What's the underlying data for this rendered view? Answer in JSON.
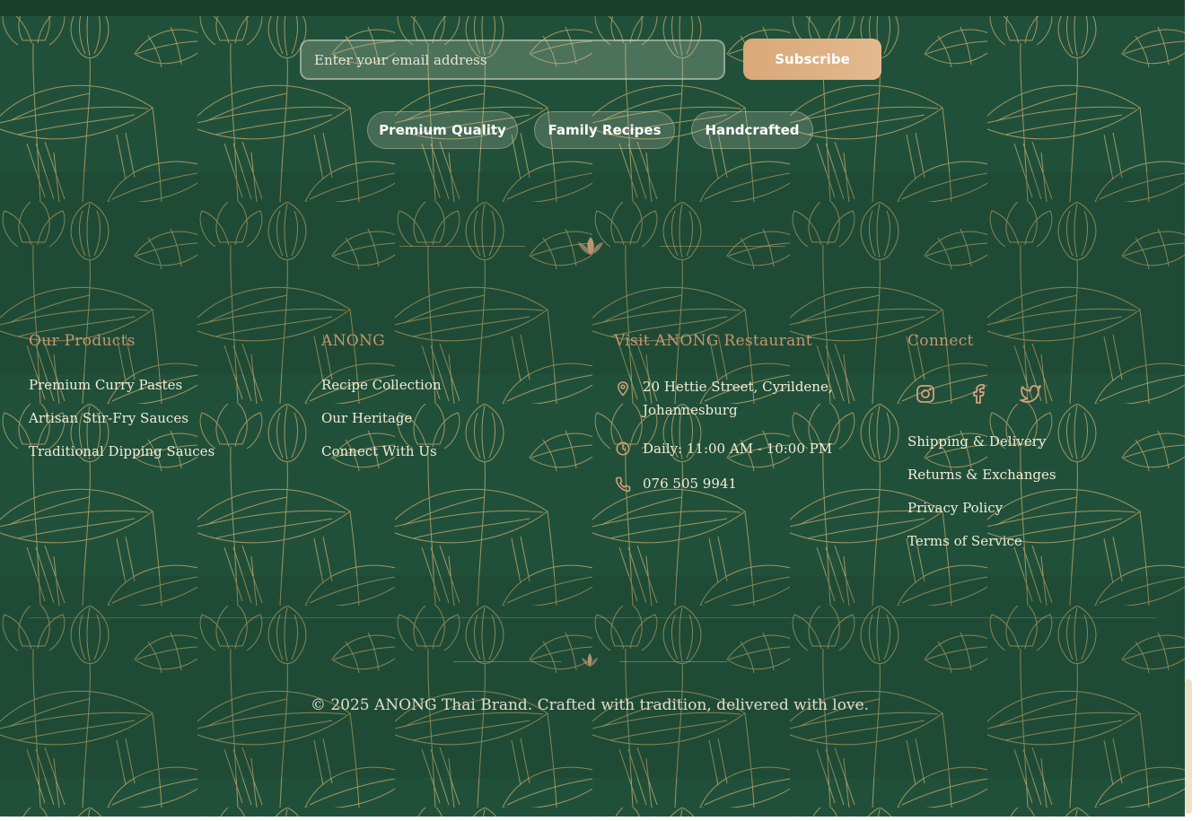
{
  "newsletter": {
    "email_placeholder": "Enter your email address",
    "subscribe_label": "Subscribe"
  },
  "badges": [
    "Premium Quality",
    "Family Recipes",
    "Handcrafted"
  ],
  "footer": {
    "products": {
      "heading": "Our Products",
      "links": [
        "Premium Curry Pastes",
        "Artisan Stir-Fry Sauces",
        "Traditional Dipping Sauces"
      ]
    },
    "brand": {
      "heading": "ANONG",
      "links": [
        "Recipe Collection",
        "Our Heritage",
        "Connect With Us"
      ]
    },
    "restaurant": {
      "heading": "Visit ANONG Restaurant",
      "address_line1": "20 Hettie Street, Cyrildene,",
      "address_line2": "Johannesburg",
      "hours": "Daily: 11:00 AM - 10:00 PM",
      "phone": "076 505 9941",
      "icons": [
        "map-pin-icon",
        "clock-icon",
        "phone-icon"
      ]
    },
    "connect": {
      "heading": "Connect",
      "social_icons": [
        "instagram-icon",
        "facebook-icon",
        "twitter-icon"
      ],
      "links": [
        "Shipping & Delivery",
        "Returns & Exchanges",
        "Privacy Policy",
        "Terms of Service"
      ]
    }
  },
  "copyright": "© 2025 ANONG Thai Brand. Crafted with tradition, delivered with love.",
  "colors": {
    "background_green": "#1f4a34",
    "gold_line": "#d8b46e",
    "accent_tan": "#d9a878",
    "heading_copper": "#c9956a",
    "text_cream": "#f1ecd9"
  }
}
